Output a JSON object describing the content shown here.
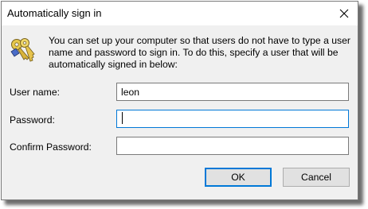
{
  "window": {
    "title": "Automatically sign in",
    "close_icon": "close-icon"
  },
  "intro": {
    "icon": "keys-icon",
    "text": "You can set up your computer so that users do not have to type a user name and password to sign in. To do this, specify a user that will be automatically signed in below:"
  },
  "form": {
    "username_label": "User name:",
    "username_value": "leon",
    "password_label": "Password:",
    "password_value": "",
    "confirm_label": "Confirm Password:",
    "confirm_value": ""
  },
  "buttons": {
    "ok_label": "OK",
    "cancel_label": "Cancel"
  },
  "colors": {
    "accent": "#0078d7",
    "dialog_bg": "#f0f0f0",
    "button_bg": "#e1e1e1"
  }
}
